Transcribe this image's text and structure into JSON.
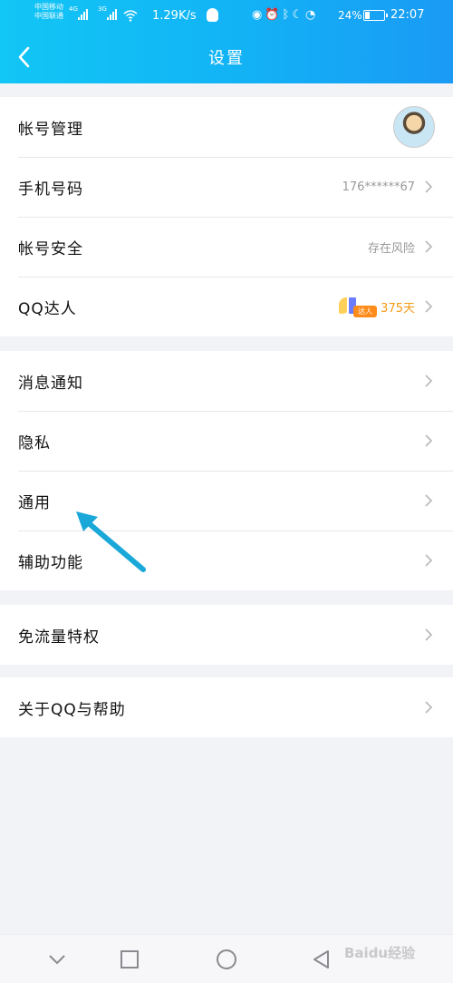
{
  "status_bar": {
    "carrier_1": "中国移动",
    "carrier_2": "中国联通",
    "net_1": "4G",
    "net_2": "3G",
    "speed": "1.29K/s",
    "battery": "24%",
    "time": "22:07",
    "icons": [
      "eye-icon",
      "alarm-icon",
      "bluetooth-icon",
      "moon-icon",
      "gauge-icon"
    ]
  },
  "header": {
    "title": "设置",
    "back_icon": "back-chevron-icon"
  },
  "groups": [
    {
      "items": [
        {
          "label": "帐号管理",
          "value": "",
          "extra": "avatar"
        },
        {
          "label": "手机号码",
          "value": "176******67"
        },
        {
          "label": "帐号安全",
          "value": "存在风险"
        },
        {
          "label": "QQ达人",
          "badge_text": "达人",
          "value": "375天"
        }
      ]
    },
    {
      "items": [
        {
          "label": "消息通知"
        },
        {
          "label": "隐私"
        },
        {
          "label": "通用"
        },
        {
          "label": "辅助功能"
        }
      ]
    },
    {
      "items": [
        {
          "label": "免流量特权"
        }
      ]
    },
    {
      "items": [
        {
          "label": "关于QQ与帮助"
        }
      ]
    }
  ],
  "annotation": {
    "color": "#19a8d8",
    "points_to": "通用"
  },
  "nav_bar": {
    "buttons": [
      "down-chevron-icon",
      "square-icon",
      "circle-icon",
      "back-triangle-icon"
    ]
  },
  "watermark": "Baidu经验",
  "colors": {
    "header_start": "#12c6f5",
    "header_end": "#1a9af5",
    "badge_orange": "#f59a12"
  }
}
